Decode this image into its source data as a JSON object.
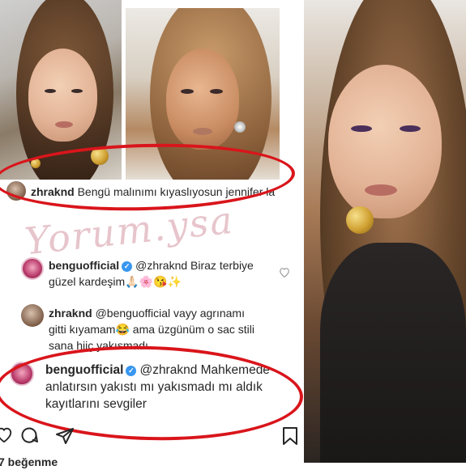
{
  "comments": [
    {
      "username": "zhraknd",
      "text": "Bengü malınımı kıyaslıyosun jennifer la"
    },
    {
      "username": "benguofficial",
      "line1": "@zhraknd Biraz terbiye",
      "line2": "güzel kardeşim🙏🏻🌸😘✨"
    },
    {
      "username": "zhraknd",
      "line1": "@benguofficial vayy agrınamı",
      "line2": "gitti kıyamam😂  ama üzgünüm o sac stili",
      "line3": "sana hiiç yakısmadı"
    },
    {
      "username": "benguofficial",
      "line1": "@zhraknd Mahkemede",
      "line2": "anlatırsın yakıstı mı yakısmadı mı aldık",
      "line3": "kayıtlarını sevgiler"
    }
  ],
  "watermark": "Yorum.ysa",
  "footer": {
    "likes_partial": "7 beğenme"
  },
  "colors": {
    "annotation_red": "#d9151b",
    "verified_blue": "#3897f0",
    "watermark_pink": "#e3bcc4"
  },
  "icons": [
    "heart-icon",
    "comment-icon",
    "share-icon",
    "bookmark-icon",
    "verified-badge-icon"
  ]
}
